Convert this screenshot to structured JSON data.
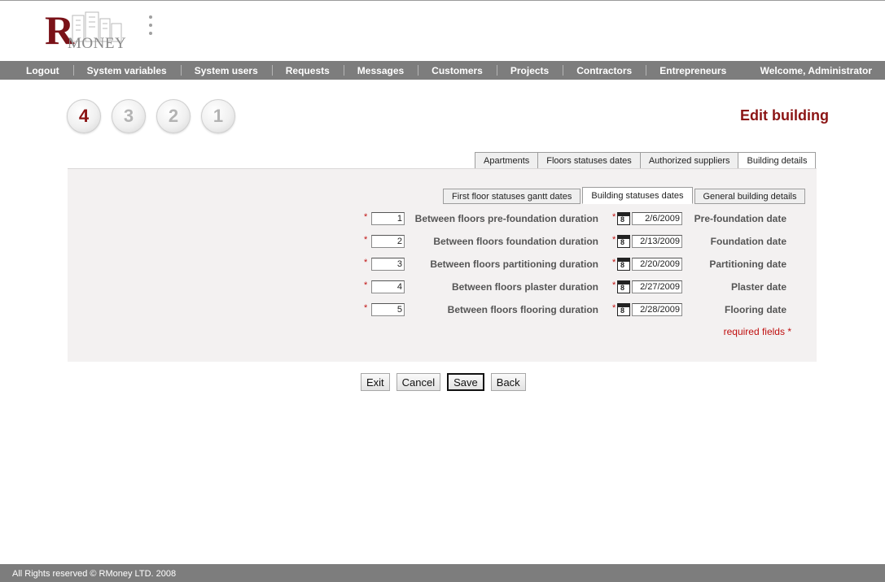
{
  "logo": {
    "letter": "R",
    "word": "MONEY"
  },
  "nav": {
    "items": [
      "Logout",
      "System variables",
      "System users",
      "Requests",
      "Messages",
      "Customers",
      "Projects",
      "Contractors",
      "Entrepreneurs"
    ],
    "welcome": "Welcome, Administrator"
  },
  "steps": [
    "4",
    "3",
    "2",
    "1"
  ],
  "page_title": "Edit building",
  "top_tabs": [
    "Apartments",
    "Floors statuses dates",
    "Authorized suppliers",
    "Building details"
  ],
  "inner_tabs": [
    "First floor statuses gantt dates",
    "Building statuses dates",
    "General building details"
  ],
  "required_mark": "*",
  "rows": [
    {
      "duration_value": "1",
      "duration_label": "Between floors pre-foundation duration",
      "date_value": "2/6/2009",
      "date_label": "Pre-foundation date"
    },
    {
      "duration_value": "2",
      "duration_label": "Between floors foundation duration",
      "date_value": "2/13/2009",
      "date_label": "Foundation date"
    },
    {
      "duration_value": "3",
      "duration_label": "Between floors partitioning duration",
      "date_value": "2/20/2009",
      "date_label": "Partitioning date"
    },
    {
      "duration_value": "4",
      "duration_label": "Between floors plaster duration",
      "date_value": "2/27/2009",
      "date_label": "Plaster date"
    },
    {
      "duration_value": "5",
      "duration_label": "Between floors flooring duration",
      "date_value": "2/28/2009",
      "date_label": "Flooring date"
    }
  ],
  "required_note": "required fields *",
  "buttons": {
    "exit": "Exit",
    "cancel": "Cancel",
    "save": "Save",
    "back": "Back"
  },
  "footer": "All Rights reserved © RMoney LTD. 2008",
  "colors": {
    "brand_red": "#8b1414",
    "nav_gray": "#7d7d7d",
    "required_red": "#c01010",
    "panel_bg": "#f3f1f1"
  }
}
